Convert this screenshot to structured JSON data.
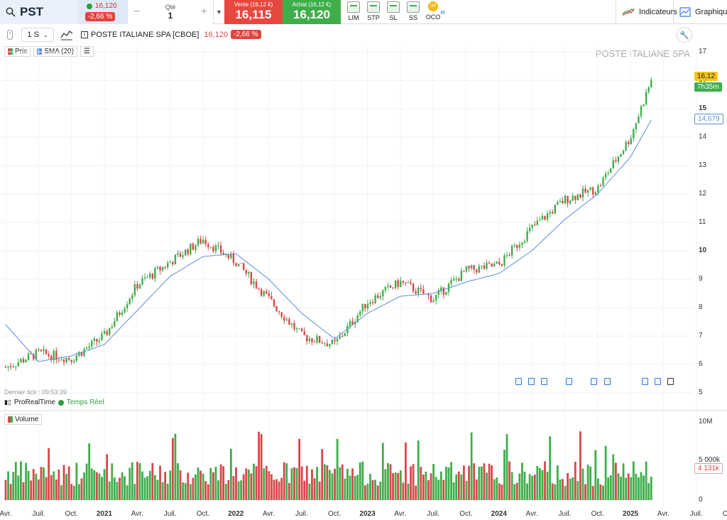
{
  "header": {
    "ticker": "PST",
    "last_price": "16,120",
    "change_pct": "-2,66 %",
    "qty_label": "Qté",
    "qty_value": "1",
    "minus": "−",
    "plus": "+",
    "sell_label": "Vente (16,12 €)",
    "sell_price": "16,115",
    "buy_label": "Achat (16,12 €)",
    "buy_price": "16,120",
    "order_types": [
      "LIM",
      "STP",
      "SL",
      "SS",
      "OCO"
    ],
    "oco_badge": "OR",
    "indicators_label": "Indicateurs",
    "chart_label": "Graphique"
  },
  "toolbar": {
    "interval": "1 S",
    "instrument": "POSTE ITALIANE SPA [CBOE]",
    "price": "16,120",
    "change": "-2,66 %"
  },
  "legend": {
    "price": "Prix",
    "sma": "SMA (20)",
    "volume": "Volume"
  },
  "watermark": "POSTE ITALIANE SPA",
  "footer": {
    "last_tick": "Dernier tick : 09:53:39",
    "provider": "ProRealTime",
    "realtime": "Temps Réel"
  },
  "price_labels": {
    "last": "16,12",
    "countdown": "7h35m",
    "sma": "14,679",
    "last_volume": "4 131k"
  },
  "colors": {
    "up": "#3fae4a",
    "down": "#d9474a",
    "sma": "#5b8fd6",
    "sell": "#e8473f",
    "buy": "#3fae4a",
    "last_price_bg": "#f3c41b",
    "countdown_bg": "#3fae4a"
  },
  "chart_data": [
    {
      "type": "candlestick",
      "title": "POSTE ITALIANE SPA",
      "interval": "1 S",
      "series": [
        {
          "name": "Prix",
          "x": [
            "2020-04",
            "2020-07",
            "2020-10",
            "2021-01",
            "2021-04",
            "2021-07",
            "2021-10",
            "2022-01",
            "2022-04",
            "2022-07",
            "2022-10",
            "2023-01",
            "2023-04",
            "2023-07",
            "2023-10",
            "2024-01",
            "2024-04",
            "2024-07",
            "2024-10",
            "2025-01",
            "2025-03"
          ],
          "close": [
            5.9,
            6.4,
            6.2,
            7.0,
            8.8,
            9.6,
            10.4,
            9.6,
            8.3,
            7.0,
            6.7,
            8.2,
            8.9,
            8.3,
            9.3,
            9.5,
            10.8,
            11.8,
            12.2,
            14.0,
            16.12
          ]
        },
        {
          "name": "SMA (20)",
          "x": [
            "2020-04",
            "2020-07",
            "2020-10",
            "2021-01",
            "2021-04",
            "2021-07",
            "2021-10",
            "2022-01",
            "2022-04",
            "2022-07",
            "2022-10",
            "2023-01",
            "2023-04",
            "2023-07",
            "2023-10",
            "2024-01",
            "2024-04",
            "2024-07",
            "2024-10",
            "2025-01",
            "2025-03"
          ],
          "values": [
            7.4,
            6.1,
            6.3,
            6.7,
            7.9,
            9.1,
            9.8,
            9.9,
            9.0,
            7.8,
            6.9,
            7.8,
            8.4,
            8.5,
            8.9,
            9.2,
            10.0,
            11.1,
            12.0,
            13.3,
            14.679
          ]
        }
      ],
      "ylim": [
        5,
        17
      ],
      "yticks": [
        "17",
        "16",
        "15",
        "14",
        "13",
        "12",
        "11",
        "10",
        "9",
        "8",
        "7",
        "6",
        "5"
      ],
      "xticks": [
        {
          "label": "Avr.",
          "year": false,
          "at": "2020-04"
        },
        {
          "label": "Juil.",
          "year": false,
          "at": "2020-07"
        },
        {
          "label": "Oct.",
          "year": false,
          "at": "2020-10"
        },
        {
          "label": "2021",
          "year": true,
          "at": "2021-01"
        },
        {
          "label": "Avr.",
          "year": false,
          "at": "2021-04"
        },
        {
          "label": "Juil.",
          "year": false,
          "at": "2021-07"
        },
        {
          "label": "Oct.",
          "year": false,
          "at": "2021-10"
        },
        {
          "label": "2022",
          "year": true,
          "at": "2022-01"
        },
        {
          "label": "Avr.",
          "year": false,
          "at": "2022-04"
        },
        {
          "label": "Juil.",
          "year": false,
          "at": "2022-07"
        },
        {
          "label": "Oct.",
          "year": false,
          "at": "2022-10"
        },
        {
          "label": "2023",
          "year": true,
          "at": "2023-01"
        },
        {
          "label": "Avr.",
          "year": false,
          "at": "2023-04"
        },
        {
          "label": "Juil.",
          "year": false,
          "at": "2023-07"
        },
        {
          "label": "Oct.",
          "year": false,
          "at": "2023-10"
        },
        {
          "label": "2024",
          "year": true,
          "at": "2024-01"
        },
        {
          "label": "Avr.",
          "year": false,
          "at": "2024-04"
        },
        {
          "label": "Juil.",
          "year": false,
          "at": "2024-07"
        },
        {
          "label": "Oct.",
          "year": false,
          "at": "2024-10"
        },
        {
          "label": "2025",
          "year": true,
          "at": "2025-01"
        },
        {
          "label": "Avr.",
          "year": false,
          "at": "2025-04"
        },
        {
          "label": "Juil.",
          "year": false,
          "at": "2025-07"
        },
        {
          "label": "Oct.",
          "year": false,
          "at": "2025-10"
        }
      ],
      "grid": true
    },
    {
      "type": "bar",
      "title": "Volume",
      "ylim": [
        0,
        10000000
      ],
      "yticks": [
        "10M",
        "5 000k",
        "0"
      ],
      "last_value": 4131000
    }
  ]
}
